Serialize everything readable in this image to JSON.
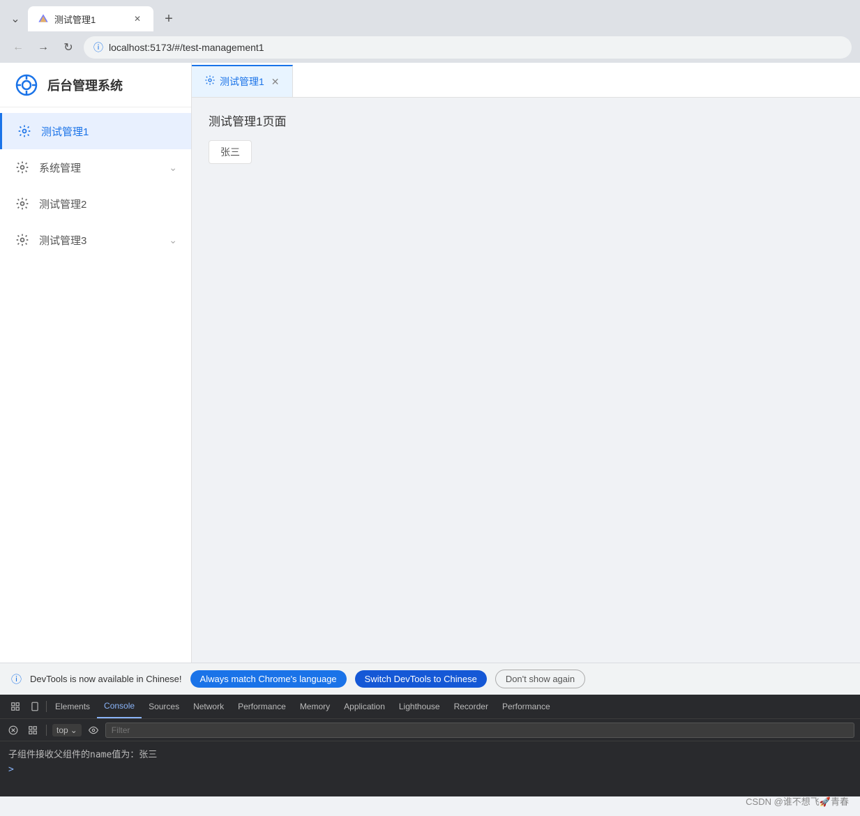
{
  "browser": {
    "tab_label": "测试管理1",
    "url": "localhost:5173/#/test-management1",
    "new_tab_label": "+",
    "back_disabled": false,
    "forward_disabled": true
  },
  "app": {
    "logo_text": "⚙",
    "title": "后台管理系统",
    "active_tab_icon": "⚙",
    "active_tab_label": "测试管理1",
    "page_title": "测试管理1页面",
    "name_value": "张三"
  },
  "sidebar": {
    "menu_items": [
      {
        "icon": "⚙",
        "label": "测试管理1",
        "active": true,
        "has_arrow": false
      },
      {
        "icon": "⚙",
        "label": "系统管理",
        "active": false,
        "has_arrow": true
      },
      {
        "icon": "⚙",
        "label": "测试管理2",
        "active": false,
        "has_arrow": false
      },
      {
        "icon": "⚙",
        "label": "测试管理3",
        "active": false,
        "has_arrow": true
      }
    ]
  },
  "devtools": {
    "notification_text": "DevTools is now available in Chinese!",
    "btn_always_match": "Always match Chrome's language",
    "btn_switch_chinese": "Switch DevTools to Chinese",
    "btn_dont_show": "Don't show again",
    "tabs": [
      {
        "label": "Elements",
        "active": false
      },
      {
        "label": "Console",
        "active": true
      },
      {
        "label": "Sources",
        "active": false
      },
      {
        "label": "Network",
        "active": false
      },
      {
        "label": "Performance",
        "active": false
      },
      {
        "label": "Memory",
        "active": false
      },
      {
        "label": "Application",
        "active": false
      },
      {
        "label": "Lighthouse",
        "active": false
      },
      {
        "label": "Recorder",
        "active": false
      },
      {
        "label": "Performance",
        "active": false
      }
    ],
    "top_label": "top",
    "filter_placeholder": "Filter",
    "console_log": "子组件接收父组件的name值为：张三"
  },
  "watermark": "CSDN @谁不想飞🚀青春"
}
